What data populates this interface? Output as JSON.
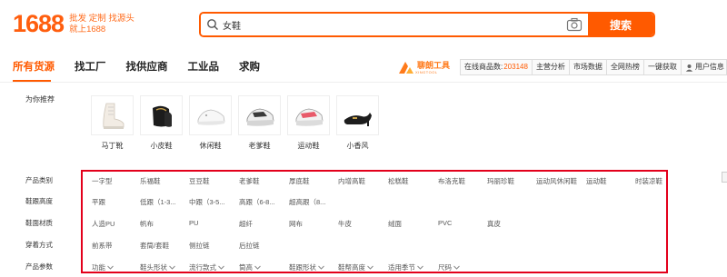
{
  "header": {
    "logo": "1688",
    "slogan_line1": "批发 定制 找源头",
    "slogan_line2": "就上1688",
    "search_value": "女鞋",
    "search_button": "搜索"
  },
  "nav": {
    "items": [
      "所有货源",
      "找工厂",
      "找供应商",
      "工业品",
      "求购"
    ],
    "active_index": 0
  },
  "brand": {
    "name": "聊朗工具",
    "subtitle": "XINGTOOL"
  },
  "toolbar": {
    "online_label": "在线商品数:",
    "online_count": "203148",
    "items": [
      "主营分析",
      "市场数据",
      "全网热榜",
      "一键获取",
      "用户信息"
    ]
  },
  "recommend": {
    "label": "为你推荐",
    "items": [
      "马丁靴",
      "小皮鞋",
      "休闲鞋",
      "老爹鞋",
      "运动鞋",
      "小香风"
    ]
  },
  "filters": {
    "rows": [
      {
        "label": "产品类别",
        "options": [
          "一字型",
          "乐福鞋",
          "豆豆鞋",
          "老爹鞋",
          "厚底鞋",
          "内增高鞋",
          "松糕鞋",
          "布洛克鞋",
          "玛丽珍鞋",
          "运动风休闲鞋",
          "运动鞋",
          "时装凉鞋"
        ]
      },
      {
        "label": "鞋跟高度",
        "options": [
          "平跟",
          "低跟（1-3...",
          "中跟（3-5...",
          "高跟（6-8...",
          "超高跟（8..."
        ]
      },
      {
        "label": "鞋面材质",
        "options": [
          "人造PU",
          "帆布",
          "PU",
          "超纤",
          "网布",
          "牛皮",
          "绒面",
          "PVC",
          "真皮"
        ]
      },
      {
        "label": "穿着方式",
        "options": [
          "前系带",
          "套筒/套鞋",
          "侧拉链",
          "后拉链"
        ]
      },
      {
        "label": "产品参数",
        "options": [
          "功能",
          "鞋头形状",
          "流行款式",
          "筒高",
          "鞋跟形状",
          "鞋帮高度",
          "适用季节",
          "尺码"
        ]
      }
    ]
  },
  "colors": {
    "accent": "#ff5a00",
    "highlight_border": "#e3001b"
  }
}
